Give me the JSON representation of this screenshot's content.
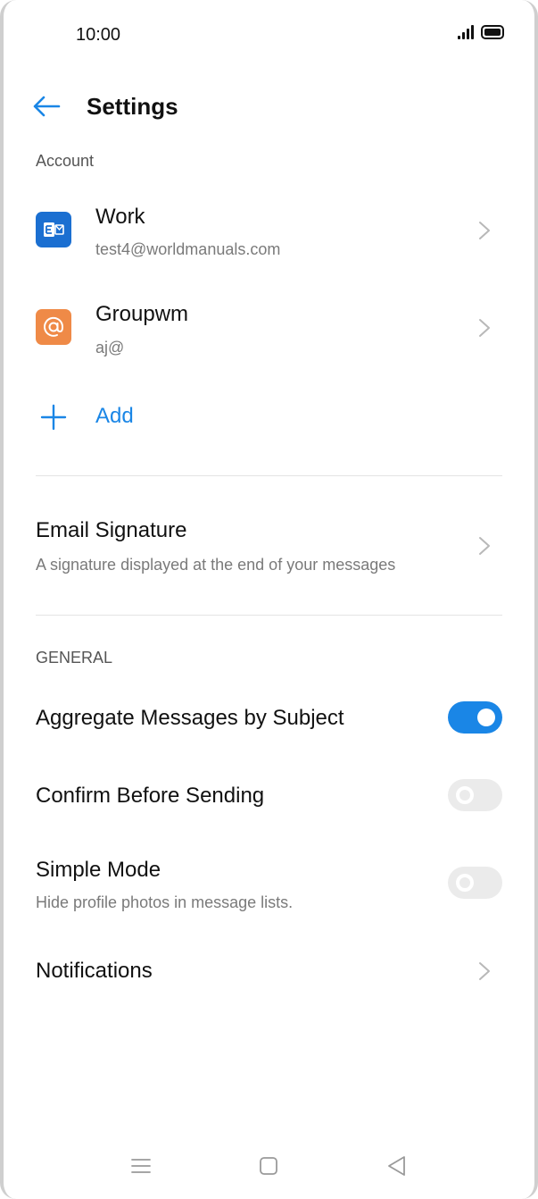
{
  "status_bar": {
    "time": "10:00"
  },
  "header": {
    "title": "Settings"
  },
  "account_section": {
    "label": "Account",
    "accounts": [
      {
        "name": "Work",
        "email": "test4@worldmanuals.com",
        "icon": "exchange-icon",
        "color": "#1b6fd1"
      },
      {
        "name": "Groupwm",
        "email": "aj@",
        "icon": "at-sign-icon",
        "color": "#ef8a47"
      }
    ],
    "add_label": "Add"
  },
  "signature": {
    "title": "Email Signature",
    "subtitle": "A signature displayed at the end of your messages"
  },
  "general_section": {
    "label": "GENERAL",
    "items": [
      {
        "title": "Aggregate Messages by Subject",
        "toggle": true
      },
      {
        "title": "Confirm Before Sending",
        "toggle": false
      },
      {
        "title": "Simple Mode",
        "subtitle": "Hide profile photos in message lists.",
        "toggle": false
      }
    ],
    "notifications": "Notifications"
  },
  "colors": {
    "accent": "#1a86e6",
    "text": "#111111",
    "secondary": "#7a7a7a"
  }
}
